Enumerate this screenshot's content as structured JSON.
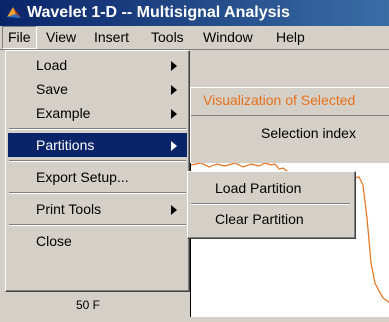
{
  "window": {
    "title": "Wavelet 1-D  --  Multisignal Analysis"
  },
  "menubar": [
    "File",
    "View",
    "Insert",
    "Tools",
    "Window",
    "Help"
  ],
  "file_menu": {
    "items": [
      {
        "label": "Load",
        "submenu": true
      },
      {
        "label": "Save",
        "submenu": true
      },
      {
        "label": "Example",
        "submenu": true
      },
      {
        "label": "Partitions",
        "submenu": true,
        "highlighted": true
      },
      {
        "label": "Export Setup...",
        "submenu": false
      },
      {
        "label": "Print Tools",
        "submenu": true
      },
      {
        "label": "Close",
        "submenu": false
      }
    ]
  },
  "partitions_submenu": {
    "items": [
      "Load Partition",
      "Clear Partition"
    ]
  },
  "panel": {
    "visualization_label": "Visualization of Selected",
    "selection_label": "Selection index"
  },
  "plot": {
    "y_tick": "50 F"
  },
  "colors": {
    "highlight": "#0a246a",
    "signal": "#e8701a"
  }
}
